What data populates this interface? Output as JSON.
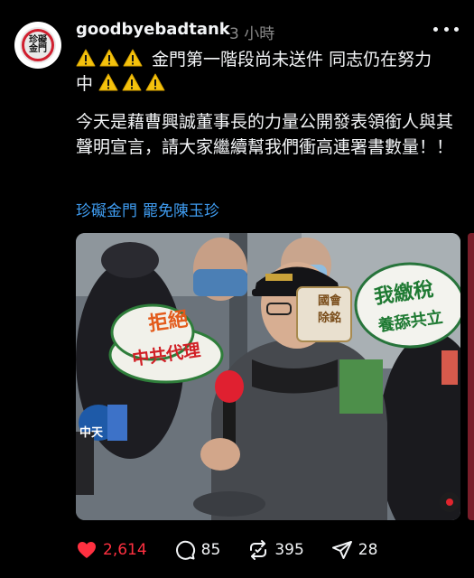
{
  "post": {
    "author": "goodbyebadtank",
    "timestamp": "3 小時",
    "avatar_text": "珍礙金門",
    "headline_part1": "金門第一階段尚未送件 同志仍在努力",
    "headline_part2": "中",
    "body": "今天是藉曹興誠董事長的力量公開發表領銜人與其聲明宣言，請大家繼續幫我們衝高連署書數量！！",
    "hashtags": [
      "珍礙金門",
      "罷免陳玉珍"
    ],
    "media_signs": {
      "sign_left": "拒絕",
      "sign_left_2": "中共代理",
      "sign_right": "我繳稅",
      "sign_right_2": "養舔共立",
      "sign_center": "國會",
      "sign_center_2": "除銘",
      "mic_flag": "中天"
    }
  },
  "actions": {
    "likes": "2,614",
    "comments": "85",
    "reposts": "395",
    "shares": "28"
  },
  "colors": {
    "background": "#000000",
    "text": "#f3f5f7",
    "muted": "#8a8a8a",
    "hashtag": "#3f9cf0",
    "like": "#ff3040"
  }
}
